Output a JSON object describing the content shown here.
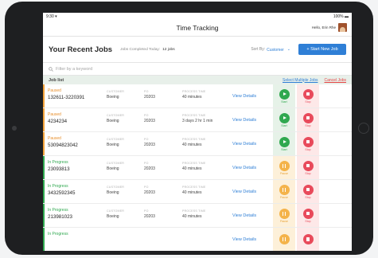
{
  "status_bar": {
    "left": "9:30 ▾",
    "right": "100% ▬"
  },
  "app": {
    "title": "Time Tracking",
    "user_greeting": "Hello, Erin Rhe"
  },
  "header": {
    "title": "Your Recent Jobs",
    "completed_label": "Jobs Completed Today:",
    "completed_value": "12 jobs",
    "sort_label": "Sort By:",
    "sort_value": "Customer",
    "start_button": "+ Start New Job"
  },
  "filter": {
    "placeholder": "Filter by a keyword"
  },
  "list": {
    "title": "Job list",
    "select_multiple": "Select Multiple Jobs",
    "cancel_jobs": "Cancel Jobs",
    "labels": {
      "customer": "CUSTOMER",
      "po": "PO",
      "process_time": "PROCESS TIME"
    },
    "view_label": "View Details",
    "rows": [
      {
        "status": "Paused",
        "job": "132611-3220391",
        "customer": "Boeing",
        "po": "20203",
        "time": "40 minutes",
        "primary": "Start",
        "secondary": "Stop"
      },
      {
        "status": "Paused",
        "job": "4234234",
        "customer": "Boeing",
        "po": "20203",
        "time": "3 days 2 hr 1 min",
        "primary": "Start",
        "secondary": "Stop"
      },
      {
        "status": "Paused",
        "job": "53094823042",
        "customer": "Boeing",
        "po": "20203",
        "time": "40 minutes",
        "primary": "Start",
        "secondary": "Stop"
      },
      {
        "status": "In Progress",
        "job": "23093813",
        "customer": "Boeing",
        "po": "20203",
        "time": "40 minutes",
        "primary": "Pause",
        "secondary": "Stop"
      },
      {
        "status": "In Progress",
        "job": "3432592345",
        "customer": "Boeing",
        "po": "20203",
        "time": "40 minutes",
        "primary": "Pause",
        "secondary": "Stop"
      },
      {
        "status": "In Progress",
        "job": "213981023",
        "customer": "Boeing",
        "po": "20203",
        "time": "40 minutes",
        "primary": "Pause",
        "secondary": "Stop"
      },
      {
        "status": "In Progress",
        "job": "",
        "customer": "",
        "po": "",
        "time": "",
        "primary": "",
        "secondary": ""
      }
    ]
  }
}
